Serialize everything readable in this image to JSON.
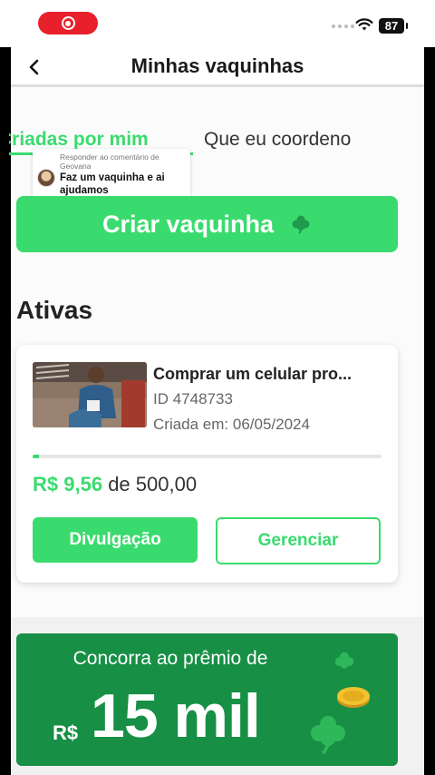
{
  "status_bar": {
    "battery": "87"
  },
  "header": {
    "title": "Minhas vaquinhas"
  },
  "tabs": [
    {
      "label": "Criadas por mim",
      "active": true
    },
    {
      "label": "Que eu coordeno",
      "active": false
    }
  ],
  "comment_overlay": {
    "reply_label": "Responder ao comentário de Geovana",
    "text": "Faz um vaquinha e ai ajudamos"
  },
  "create_button": {
    "label": "Criar vaquinha",
    "icon": "clover-icon"
  },
  "section": {
    "title": "Ativas"
  },
  "campaign_card": {
    "title": "Comprar um celular pro...",
    "id_text": "ID 4748733",
    "created_text": "Criada em: 06/05/2024",
    "raised": "R$ 9,56",
    "of_text": "de 500,00",
    "progress_fraction": 0.019,
    "primary_button": "Divulgação",
    "secondary_button": "Gerenciar"
  },
  "promo": {
    "text": "Concorra ao prêmio de",
    "currency": "R$",
    "amount": "15 mil"
  },
  "colors": {
    "accent": "#3adb6e",
    "promo_bg": "#178f45",
    "record": "#e8202c"
  }
}
